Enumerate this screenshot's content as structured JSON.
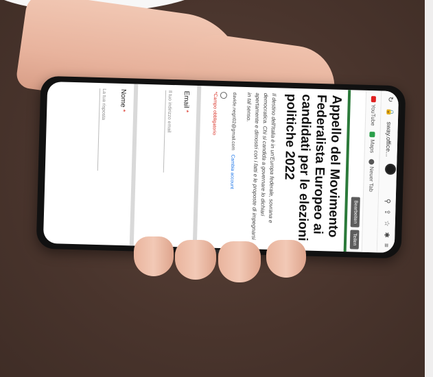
{
  "browser": {
    "url": "sway.office...",
    "bookmarks": [
      "YouTube",
      "Maps",
      "Neuer Tab"
    ]
  },
  "form": {
    "toolbar": [
      "Bearbeiten",
      "Teilen"
    ],
    "title": "Appello del Movimento Federalista Europeo ai candidati per le elezioni politiche 2022",
    "description": "Il destino dell'Italia è in un'Europa federale, sovrana e democratica. Chi si candida a governare lo dichiari apertamente e dimostri con i fatti e le proposte di impegnarsi in tal senso.",
    "account_email": "davide.negri02@gmail.com",
    "switch_account": "Cambia account",
    "required_note": "*Campo obbligatorio",
    "fields": [
      {
        "label": "Email",
        "required": "*",
        "placeholder": "Il tuo indirizzo email"
      },
      {
        "label": "Nome",
        "required": "*",
        "placeholder": "La tua risposta"
      }
    ]
  },
  "colors": {
    "accent_green": "#2b7a3a",
    "background": "#4a352d",
    "link_blue": "#1a73e8",
    "required_red": "#d93025"
  }
}
